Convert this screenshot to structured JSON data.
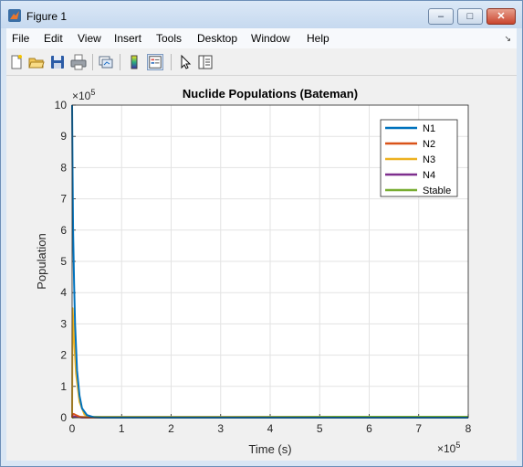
{
  "window": {
    "title": "Figure 1",
    "minimize_label": "–",
    "maximize_label": "□",
    "close_label": "✕"
  },
  "menu": {
    "items": [
      "File",
      "Edit",
      "View",
      "Insert",
      "Tools",
      "Desktop",
      "Window",
      "Help"
    ]
  },
  "toolbar": {
    "icons": [
      "new-figure-icon",
      "open-file-icon",
      "save-icon",
      "print-icon",
      "link-plot-icon",
      "colorbar-icon",
      "legend-icon",
      "pointer-icon",
      "property-editor-icon"
    ]
  },
  "colors": {
    "N1": "#0072BD",
    "N2": "#D95319",
    "N3": "#EDB120",
    "N4": "#7E2F8E",
    "Stable": "#77AC30"
  },
  "chart_data": {
    "type": "line",
    "title": "Nuclide Populations (Bateman)",
    "xlabel": "Time (s)",
    "ylabel": "Population",
    "x_exponent_label": "×10",
    "x_exponent": "5",
    "y_exponent_label": "×10",
    "y_exponent": "5",
    "xlim": [
      0,
      800000
    ],
    "ylim": [
      0,
      1000000
    ],
    "xticks": [
      0,
      100000,
      200000,
      300000,
      400000,
      500000,
      600000,
      700000,
      800000
    ],
    "xtick_labels": [
      "0",
      "1",
      "2",
      "3",
      "4",
      "5",
      "6",
      "7",
      "8"
    ],
    "yticks": [
      0,
      100000,
      200000,
      300000,
      400000,
      500000,
      600000,
      700000,
      800000,
      900000,
      1000000
    ],
    "ytick_labels": [
      "0",
      "1",
      "2",
      "3",
      "4",
      "5",
      "6",
      "7",
      "8",
      "9",
      "10"
    ],
    "grid": true,
    "legend_position": "top-right",
    "series": [
      {
        "name": "N1",
        "x": [
          0,
          1000,
          2000,
          4000,
          6000,
          10000,
          15000,
          20000,
          30000,
          45000,
          60000,
          800000
        ],
        "values": [
          1000000,
          780000,
          600000,
          430000,
          300000,
          150000,
          70000,
          30000,
          8000,
          1000,
          0,
          0
        ]
      },
      {
        "name": "N2",
        "x": [
          0,
          1000,
          3000,
          8000,
          15000,
          30000,
          800000
        ],
        "values": [
          0,
          10000,
          12000,
          8000,
          3000,
          500,
          0
        ]
      },
      {
        "name": "N3",
        "x": [
          0,
          1000,
          2000,
          4000,
          8000,
          15000,
          25000,
          40000,
          800000
        ],
        "values": [
          0,
          350000,
          320000,
          250000,
          140000,
          50000,
          10000,
          500,
          0
        ]
      },
      {
        "name": "N4",
        "x": [
          0,
          2000,
          8000,
          20000,
          800000
        ],
        "values": [
          0,
          4000,
          3000,
          500,
          0
        ]
      },
      {
        "name": "Stable",
        "x": [
          0,
          5000,
          30000,
          800000
        ],
        "values": [
          0,
          1000,
          2500,
          3000
        ]
      }
    ]
  }
}
